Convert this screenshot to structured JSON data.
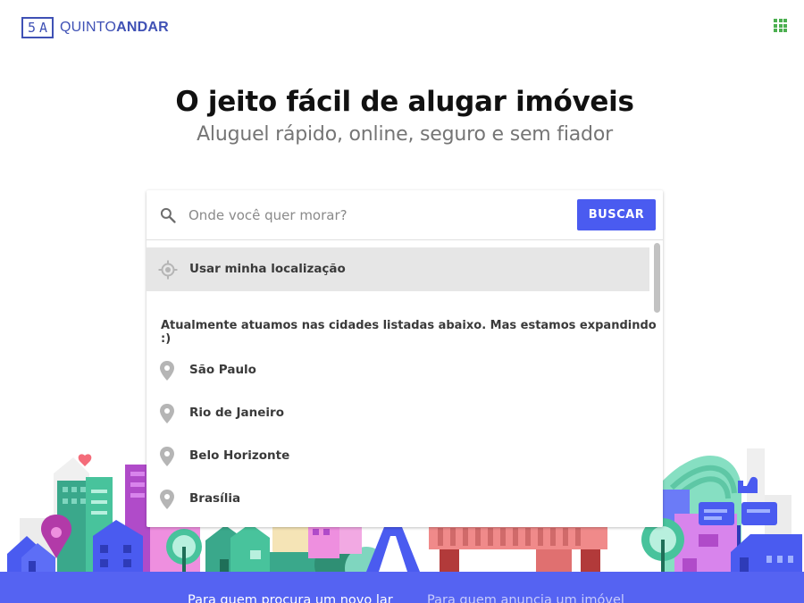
{
  "header": {
    "logo_mark_left": "5",
    "logo_mark_right": "A",
    "logo_text_light": "QUINTO",
    "logo_text_bold": "ANDAR",
    "apps_icon": "apps-grid-icon",
    "apps_color": "#4caf50"
  },
  "hero": {
    "title": "O jeito fácil de alugar imóveis",
    "subtitle": "Aluguel rápido, online, seguro e sem fiador"
  },
  "search": {
    "placeholder": "Onde você quer morar?",
    "value": "",
    "button_label": "BUSCAR",
    "icon": "search-icon",
    "button_color": "#4a5bf0"
  },
  "dropdown": {
    "use_location_label": "Usar minha localização",
    "use_location_icon": "gps-icon",
    "info_text": "Atualmente atuamos nas cidades listadas abaixo. Mas estamos expandindo :)",
    "city_icon": "map-pin-icon",
    "cities": [
      {
        "label": "São Paulo"
      },
      {
        "label": "Rio de Janeiro"
      },
      {
        "label": "Belo Horizonte"
      },
      {
        "label": "Brasília"
      }
    ]
  },
  "footer": {
    "link_seekers": "Para quem procura um novo lar",
    "link_owners": "Para quem anuncia um imóvel",
    "background": "#5563f2"
  }
}
